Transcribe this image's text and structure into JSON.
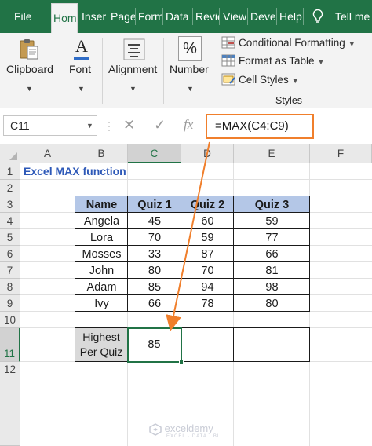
{
  "ribbon_tabs": [
    "File",
    "Hom",
    "Inser",
    "Page",
    "Form",
    "Data",
    "Revie",
    "View",
    "Deve",
    "Help"
  ],
  "active_tab": "Hom",
  "tell_me": "Tell me",
  "groups": {
    "clipboard": "Clipboard",
    "font": "Font",
    "alignment": "Alignment",
    "number": "Number",
    "number_symbol": "%",
    "font_symbol": "A"
  },
  "styles": {
    "conditional_formatting": "Conditional Formatting",
    "format_as_table": "Format as Table",
    "cell_styles": "Cell Styles",
    "label": "Styles"
  },
  "formula_bar": {
    "name_box": "C11",
    "fx_label": "fx",
    "formula": "=MAX(C4:C9)"
  },
  "columns": [
    "A",
    "B",
    "C",
    "D",
    "E",
    "F"
  ],
  "selected_column": "C",
  "rows": [
    "1",
    "2",
    "3",
    "4",
    "5",
    "6",
    "7",
    "8",
    "9",
    "10",
    "11",
    "12"
  ],
  "selected_row": "11",
  "sheet": {
    "title": "Excel MAX function",
    "table_headers": [
      "Name",
      "Quiz 1",
      "Quiz 2",
      "Quiz 3"
    ],
    "table_rows": [
      [
        "Angela",
        "45",
        "60",
        "59"
      ],
      [
        "Lora",
        "70",
        "59",
        "77"
      ],
      [
        "Mosses",
        "33",
        "87",
        "66"
      ],
      [
        "John",
        "80",
        "70",
        "81"
      ],
      [
        "Adam",
        "85",
        "94",
        "98"
      ],
      [
        "Ivy",
        "66",
        "78",
        "80"
      ]
    ],
    "highest_label_line1": "Highest",
    "highest_label_line2": "Per Quiz",
    "result_c11": "85",
    "result_d11": "",
    "result_e11": ""
  },
  "colors": {
    "excel_green": "#217346",
    "table_header_fill": "#b4c7e7",
    "label_fill": "#d9d9d9",
    "title_blue": "#2e59b8",
    "annotation_orange": "#f07f2c"
  },
  "icons": [
    "clipboard-icon",
    "font-icon",
    "alignment-icon",
    "number-format-icon",
    "conditional-formatting-icon",
    "format-as-table-icon",
    "cell-styles-icon",
    "lightbulb-icon",
    "cancel-icon",
    "enter-icon",
    "function-icon"
  ],
  "watermark": {
    "brand": "exceldemy",
    "tagline": "EXCEL · DATA · BI"
  }
}
